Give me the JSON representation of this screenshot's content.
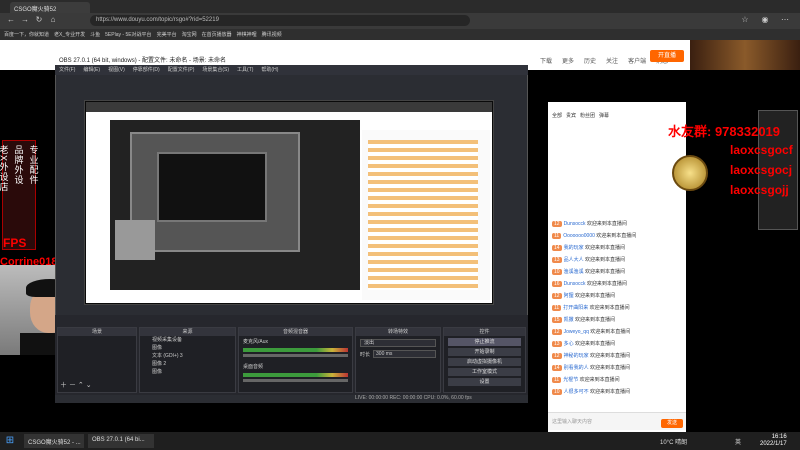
{
  "browser": {
    "tab_title": "CSGO魔火骑52",
    "url": "https://www.douyu.com/topic/rsgo#?rid=52219",
    "bookmarks": [
      "百度一下，你就知道",
      "老X_专业开发",
      "斗鱼",
      "5EPlay - 5E对战平台",
      "完美平台",
      "淘宝网",
      "在首页播放器",
      "神棋神哩",
      "腾讯视频"
    ]
  },
  "douyu": {
    "top_right": [
      "下载",
      "更多",
      "历史",
      "关注",
      "客户端",
      "消息"
    ],
    "open_stream": "开直播"
  },
  "overlay": {
    "left_ad_line1": "品牌外设",
    "left_ad_line2": "专业配件",
    "left_ad_line3": "老X外设店",
    "fps": "FPS",
    "name": "Corrine018401",
    "qq": "水友群: 978332019",
    "laox1": "laoxcsgocf",
    "laox2": "laoxcsgocj",
    "laox3": "laoxcsgojj"
  },
  "obs": {
    "title": "OBS 27.0.1 (64 bit, windows) - 配置文件: 未命名 - 场景: 未命名",
    "menu": [
      "文件(F)",
      "编辑(E)",
      "视图(V)",
      "停靠部件(D)",
      "配置文件(P)",
      "场景集合(S)",
      "工具(T)",
      "帮助(H)"
    ],
    "panels": {
      "scenes": "场景",
      "sources": "来源",
      "mixer": "音频混音器",
      "transitions": "转场特效",
      "controls": "控件"
    },
    "sources": [
      "视频采集设备",
      "图像",
      "文本 (GDI+) 3",
      "图像 2",
      "图像"
    ],
    "mixer_channels": [
      "麦克风/Aux",
      "桌面音频"
    ],
    "transition": "淡出",
    "duration_label": "时长",
    "duration": "300 ms",
    "controls": [
      "停止推流",
      "开始录制",
      "启动虚拟摄像机",
      "工作室模式",
      "设置",
      "退出"
    ],
    "status": "LIVE: 00:00:00   REC: 00:00:00   CPU: 0.0%, 60.00 fps"
  },
  "chat": {
    "tabs": [
      "全部",
      "贵宾",
      "粉丝团",
      "弹幕"
    ],
    "send": "发送",
    "input_placeholder": "这里输入聊天内容",
    "lines": [
      {
        "lvl": "12",
        "name": "Dunsocck",
        "msg": "欢迎来到本直播间"
      },
      {
        "lvl": "11",
        "name": "Ooooooo0000",
        "msg": "欢迎来到本直播间"
      },
      {
        "lvl": "14",
        "name": "我的玩家",
        "msg": "欢迎来到本直播间"
      },
      {
        "lvl": "13",
        "name": "品人大人",
        "msg": "欢迎来到本直播间"
      },
      {
        "lvl": "10",
        "name": "渔溪渔溪",
        "msg": "欢迎来到本直播间"
      },
      {
        "lvl": "16",
        "name": "Dunsocck",
        "msg": "欢迎来到本直播间"
      },
      {
        "lvl": "12",
        "name": "阿狸",
        "msg": "欢迎来到本直播间"
      },
      {
        "lvl": "11",
        "name": "打开曲阳来",
        "msg": "欢迎来到本直播间"
      },
      {
        "lvl": "15",
        "name": "凯撒",
        "msg": "欢迎来到本直播间"
      },
      {
        "lvl": "12",
        "name": "Joweyo_qq",
        "msg": "欢迎来到本直播间"
      },
      {
        "lvl": "13",
        "name": "多心",
        "msg": "欢迎来到本直播间"
      },
      {
        "lvl": "12",
        "name": "神秘的玩家",
        "msg": "欢迎来到本直播间"
      },
      {
        "lvl": "14",
        "name": "别看我的人",
        "msg": "欢迎来到本直播间"
      },
      {
        "lvl": "11",
        "name": "光棍节",
        "msg": "欢迎来到本直播间"
      },
      {
        "lvl": "10",
        "name": "人很多可不",
        "msg": "欢迎来到本直播间"
      }
    ]
  },
  "taskbar": {
    "items": [
      "CSGO魔火骑52 - ...",
      "OBS 27.0.1 (64 bi..."
    ],
    "weather": "10°C 晴朗",
    "ime": "英",
    "time": "16:16",
    "date": "2022/1/17"
  }
}
